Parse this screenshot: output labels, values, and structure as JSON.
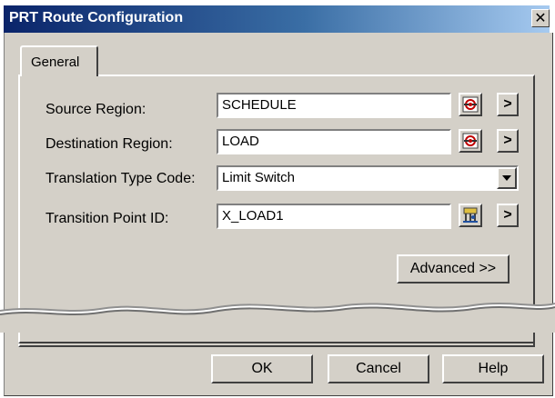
{
  "window": {
    "title": "PRT Route Configuration",
    "close_label": "✕"
  },
  "tabs": [
    {
      "label": "General"
    }
  ],
  "form": {
    "source_region": {
      "label": "Source Region:",
      "value": "SCHEDULE"
    },
    "destination_region": {
      "label": "Destination Region:",
      "value": "LOAD"
    },
    "translation_type_code": {
      "label": "Translation Type Code:",
      "selected": "Limit Switch"
    },
    "transition_point_id": {
      "label": "Transition Point ID:",
      "value": "X_LOAD1"
    },
    "arrow_label": ">",
    "advanced_label": "Advanced >>"
  },
  "buttons": {
    "ok": "OK",
    "cancel": "Cancel",
    "help": "Help"
  },
  "icons": {
    "source_picker": "region-picker-icon",
    "destination_picker": "region-picker-icon",
    "transition_picker": "transition-point-picker-icon",
    "dropdown": "chevron-down-icon"
  },
  "colors": {
    "title_start": "#0a246a",
    "title_end": "#a6caf0",
    "face": "#d4d0c8"
  }
}
